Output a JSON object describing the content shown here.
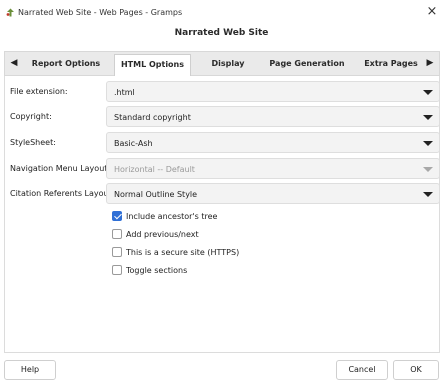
{
  "window": {
    "title": "Narrated Web Site - Web Pages - Gramps",
    "close_glyph": "×",
    "app_icon": "gramps-tree-icon"
  },
  "dialog": {
    "heading": "Narrated Web Site"
  },
  "tabs": {
    "scroll_left_glyph": "◀",
    "scroll_right_glyph": "▶",
    "items": [
      {
        "label": "Report Options",
        "active": false
      },
      {
        "label": "HTML Options",
        "active": true
      },
      {
        "label": "Display",
        "active": false
      },
      {
        "label": "Page Generation",
        "active": false
      },
      {
        "label": "Extra Pages",
        "active": false
      }
    ]
  },
  "form": {
    "rows": [
      {
        "label": "File extension:",
        "value": ".html",
        "disabled": false
      },
      {
        "label": "Copyright:",
        "value": "Standard copyright",
        "disabled": false
      },
      {
        "label": "StyleSheet:",
        "value": "Basic-Ash",
        "disabled": false
      },
      {
        "label": "Navigation Menu Layout:",
        "value": "Horizontal -- Default",
        "disabled": true
      },
      {
        "label": "Citation Referents Layout:",
        "value": "Normal Outline Style",
        "disabled": false
      }
    ],
    "checkboxes": [
      {
        "label": "Include ancestor's tree",
        "checked": true
      },
      {
        "label": "Add previous/next",
        "checked": false
      },
      {
        "label": "This is a secure site (HTTPS)",
        "checked": false
      },
      {
        "label": "Toggle sections",
        "checked": false
      }
    ]
  },
  "buttons": {
    "help": "Help",
    "cancel": "Cancel",
    "ok": "OK"
  },
  "colors": {
    "accent": "#2f6fd6",
    "tabbar_bg": "#eaeaea",
    "combo_bg": "#f3f3f3"
  }
}
